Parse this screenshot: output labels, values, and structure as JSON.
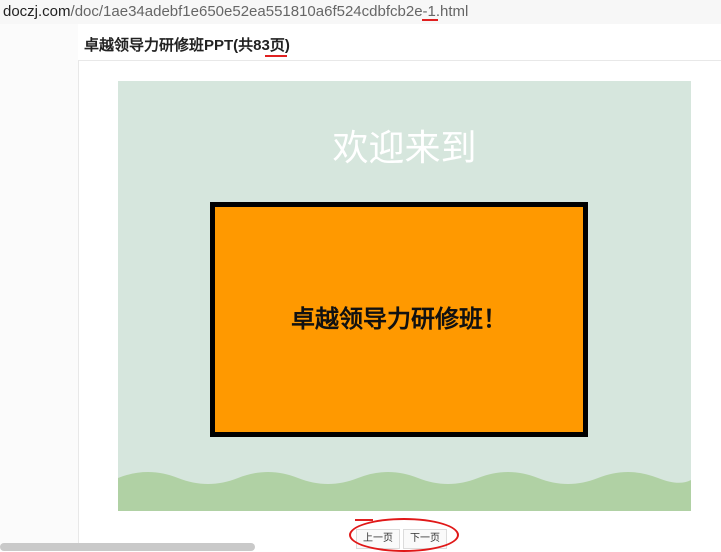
{
  "address_bar": {
    "domain": "doczj.com",
    "path": "/doc/1ae34adebf1e650e52ea551810a6f524cdbfcb2e-1.html"
  },
  "document": {
    "title": "卓越领导力研修班PPT(共83页)"
  },
  "slide": {
    "heading": "欢迎来到",
    "box_text": "卓越领导力研修班！"
  },
  "pager": {
    "prev_label": "上一页",
    "next_label": "下一页"
  },
  "colors": {
    "slide_bg": "#d6e6dd",
    "box_fill": "#ff9900",
    "wave": "#b0d1a4",
    "annotation": "#e01818"
  }
}
